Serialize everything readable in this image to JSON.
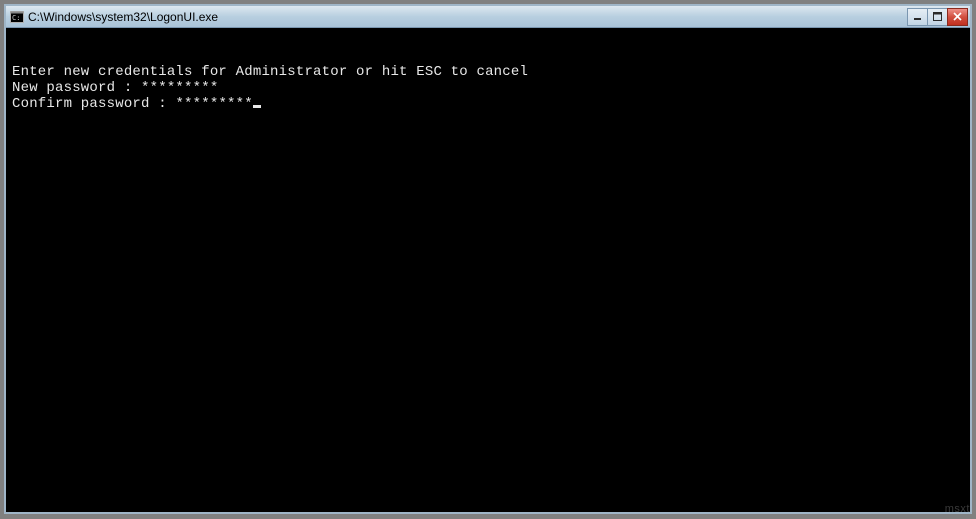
{
  "window": {
    "title": "C:\\Windows\\system32\\LogonUI.exe"
  },
  "terminal": {
    "line1_prompt": "Enter new credentials for Administrator or hit ESC to cancel",
    "line2_label": "New password : ",
    "line2_value": "*********",
    "line3_label": "Confirm password : ",
    "line3_value": "*********"
  },
  "icons": {
    "app_icon": "cmd-icon",
    "minimize": "minimize-icon",
    "maximize": "maximize-icon",
    "close": "close-icon"
  },
  "watermark": "msxt"
}
